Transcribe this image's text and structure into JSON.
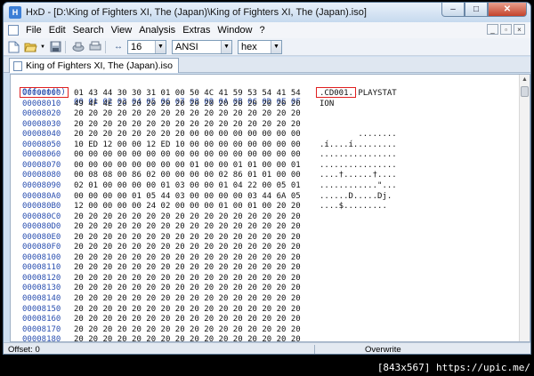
{
  "window": {
    "title": "HxD - [D:\\King of Fighters XI, The (Japan)\\King of Fighters XI, The (Japan).iso]",
    "app_icon_letter": "H",
    "controls": {
      "minimize": "–",
      "maximize": "□",
      "close": "✕"
    }
  },
  "menu": {
    "items": [
      "File",
      "Edit",
      "Search",
      "View",
      "Analysis",
      "Extras",
      "Window",
      "?"
    ],
    "mdi_controls": {
      "minimize": "_",
      "restore": "▫",
      "close": "×"
    }
  },
  "toolbar": {
    "columns_value": "16",
    "charset_value": "ANSI",
    "offset_base_value": "hex",
    "columns_icon_label": "↔"
  },
  "tab": {
    "label": "King of Fighters XI, The (Japan).iso"
  },
  "hex_view": {
    "header_offset_label": "Offset(h)",
    "header_columns": "00 01 02 03 04 05 06 07 08 09 0A 0B 0C 0D 0E 0F",
    "rows": [
      {
        "offset": "00008000",
        "hex": "01 43 44 30 30 31 01 00 50 4C 41 59 53 54 41 54",
        "text": ".CD001..PLAYSTAT"
      },
      {
        "offset": "00008010",
        "hex": "49 4F 4E 20 20 20 20 20 20 20 20 20 20 20 20 20",
        "text": "ION"
      },
      {
        "offset": "00008020",
        "hex": "20 20 20 20 20 20 20 20 20 20 20 20 20 20 20 20",
        "text": ""
      },
      {
        "offset": "00008030",
        "hex": "20 20 20 20 20 20 20 20 20 20 20 20 20 20 20 20",
        "text": ""
      },
      {
        "offset": "00008040",
        "hex": "20 20 20 20 20 20 20 20 00 00 00 00 00 00 00 00",
        "text": "        ........"
      },
      {
        "offset": "00008050",
        "hex": "10 ED 12 00 00 12 ED 10 00 00 00 00 00 00 00 00",
        "text": ".í....í........."
      },
      {
        "offset": "00008060",
        "hex": "00 00 00 00 00 00 00 00 00 00 00 00 00 00 00 00",
        "text": "................"
      },
      {
        "offset": "00008070",
        "hex": "00 00 00 00 00 00 00 00 01 00 00 01 01 00 00 01",
        "text": "................"
      },
      {
        "offset": "00008080",
        "hex": "00 08 08 00 86 02 00 00 00 00 02 86 01 01 00 00",
        "text": "....†......†...."
      },
      {
        "offset": "00008090",
        "hex": "02 01 00 00 00 00 01 03 00 00 01 04 22 00 05 01",
        "text": "............\"..."
      },
      {
        "offset": "000080A0",
        "hex": "00 00 00 00 01 05 44 03 00 00 00 00 03 44 6A 05",
        "text": "......D.....Dj."
      },
      {
        "offset": "000080B0",
        "hex": "12 00 00 00 00 24 02 00 00 00 01 00 01 00 20 20",
        "text": "....$........."
      },
      {
        "offset": "000080C0",
        "hex": "20 20 20 20 20 20 20 20 20 20 20 20 20 20 20 20",
        "text": ""
      },
      {
        "offset": "000080D0",
        "hex": "20 20 20 20 20 20 20 20 20 20 20 20 20 20 20 20",
        "text": ""
      },
      {
        "offset": "000080E0",
        "hex": "20 20 20 20 20 20 20 20 20 20 20 20 20 20 20 20",
        "text": ""
      },
      {
        "offset": "000080F0",
        "hex": "20 20 20 20 20 20 20 20 20 20 20 20 20 20 20 20",
        "text": ""
      },
      {
        "offset": "00008100",
        "hex": "20 20 20 20 20 20 20 20 20 20 20 20 20 20 20 20",
        "text": ""
      },
      {
        "offset": "00008110",
        "hex": "20 20 20 20 20 20 20 20 20 20 20 20 20 20 20 20",
        "text": ""
      },
      {
        "offset": "00008120",
        "hex": "20 20 20 20 20 20 20 20 20 20 20 20 20 20 20 20",
        "text": ""
      },
      {
        "offset": "00008130",
        "hex": "20 20 20 20 20 20 20 20 20 20 20 20 20 20 20 20",
        "text": ""
      },
      {
        "offset": "00008140",
        "hex": "20 20 20 20 20 20 20 20 20 20 20 20 20 20 20 20",
        "text": ""
      },
      {
        "offset": "00008150",
        "hex": "20 20 20 20 20 20 20 20 20 20 20 20 20 20 20 20",
        "text": ""
      },
      {
        "offset": "00008160",
        "hex": "20 20 20 20 20 20 20 20 20 20 20 20 20 20 20 20",
        "text": ""
      },
      {
        "offset": "00008170",
        "hex": "20 20 20 20 20 20 20 20 20 20 20 20 20 20 20 20",
        "text": ""
      },
      {
        "offset": "00008180",
        "hex": "20 20 20 20 20 20 20 20 20 20 20 20 20 20 20 20",
        "text": ""
      }
    ]
  },
  "status": {
    "offset": "Offset: 0",
    "mode": "Overwrite"
  },
  "watermark": "[843x567] https://upic.me/",
  "colors": {
    "offset_text": "#2a4fb0",
    "highlight": "#e02020",
    "window_frame": "#cfdff0"
  }
}
